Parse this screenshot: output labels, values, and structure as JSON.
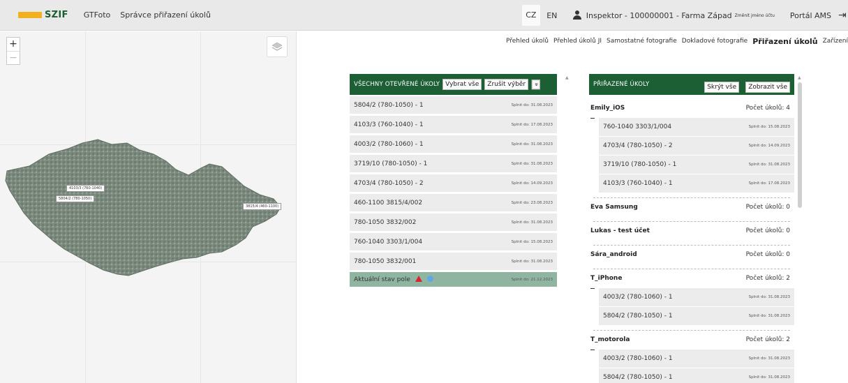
{
  "header": {
    "logo_text": "SZIF",
    "nav": [
      "GTFoto",
      "Správce přiřazení úkolů"
    ],
    "lang_cz": "CZ",
    "lang_en": "EN",
    "user": "Inspektor - 100000001 - Farma Západ",
    "change_user": "Změnit jméno účtu",
    "portal": "Portál AMS",
    "exit_icon": "exit-icon"
  },
  "map": {
    "zoom_in": "+",
    "zoom_out": "−",
    "labels": [
      "4103/3 (760-1040)",
      "5804/2 (780-1050)",
      "3815/4 (460-1100)"
    ]
  },
  "tabs": [
    "Přehled úkolů",
    "Přehled úkolů JI",
    "Samostatné fotografie",
    "Dokladové fotografie",
    "Přiřazení úkolů",
    "Zařízení"
  ],
  "active_tab_index": 4,
  "open_tasks": {
    "title": "VŠECHNY OTEVŘENÉ ÚKOLY",
    "select_all": "Vybrat vše",
    "cancel_selection": "Zrušit výběr",
    "expand_icon": "»",
    "rows": [
      {
        "label": "5804/2 (780-1050) - 1",
        "due": "Splnit do: 31.08.2023"
      },
      {
        "label": "4103/3 (760-1040) - 1",
        "due": "Splnit do: 17.08.2023"
      },
      {
        "label": "4003/2 (780-1060) - 1",
        "due": "Splnit do: 31.08.2023"
      },
      {
        "label": "3719/10 (780-1050) - 1",
        "due": "Splnit do: 31.08.2023"
      },
      {
        "label": "4703/4 (780-1050) - 2",
        "due": "Splnit do: 14.09.2023"
      },
      {
        "label": "460-1100 3815/4/002",
        "due": "Splnit do: 23.08.2023"
      },
      {
        "label": "780-1050 3832/002",
        "due": "Splnit do: 31.08.2023"
      },
      {
        "label": "760-1040 3303/1/004",
        "due": "Splnit do: 15.08.2023"
      },
      {
        "label": "780-1050 3832/001",
        "due": "Splnit do: 31.08.2023"
      }
    ],
    "status_row": {
      "label": "Aktuální stav pole",
      "due": "Splnit do: 21.12.2023"
    }
  },
  "assigned": {
    "title": "PŘIŘAZENÉ ÚKOLY",
    "hide_all": "Skrýt vše",
    "show_all": "Zobrazit vše",
    "groups": [
      {
        "name": "Emily_iOS",
        "count": "Počet úkolů: 4",
        "tasks": [
          {
            "label": "760-1040 3303/1/004",
            "due": "Splnit do: 15.08.2023"
          },
          {
            "label": "4703/4 (780-1050) - 2",
            "due": "Splnit do: 14.09.2023"
          },
          {
            "label": "3719/10 (780-1050) - 1",
            "due": "Splnit do: 31.08.2023"
          },
          {
            "label": "4103/3 (760-1040) - 1",
            "due": "Splnit do: 17.08.2023"
          }
        ]
      },
      {
        "name": "Eva Samsung",
        "count": "Počet úkolů: 0",
        "tasks": []
      },
      {
        "name": "Lukas - test účet",
        "count": "Počet úkolů: 0",
        "tasks": []
      },
      {
        "name": "Sára_android",
        "count": "Počet úkolů: 0",
        "tasks": []
      },
      {
        "name": "T_iPhone",
        "count": "Počet úkolů: 2",
        "tasks": [
          {
            "label": "4003/2 (780-1060) - 1",
            "due": "Splnit do: 31.08.2023"
          },
          {
            "label": "5804/2 (780-1050) - 1",
            "due": "Splnit do: 31.08.2023"
          }
        ]
      },
      {
        "name": "T_motorola",
        "count": "Počet úkolů: 2",
        "tasks": [
          {
            "label": "4003/2 (780-1060) - 1",
            "due": "Splnit do: 31.08.2023"
          },
          {
            "label": "5804/2 (780-1050) - 1",
            "due": "Splnit do: 31.08.2023"
          }
        ]
      }
    ]
  },
  "colors": {
    "brand_green": "#1d5f35",
    "logo_yellow": "#f2b01e",
    "warning_red": "#d9232d",
    "status_row": "#8fb5a1"
  }
}
